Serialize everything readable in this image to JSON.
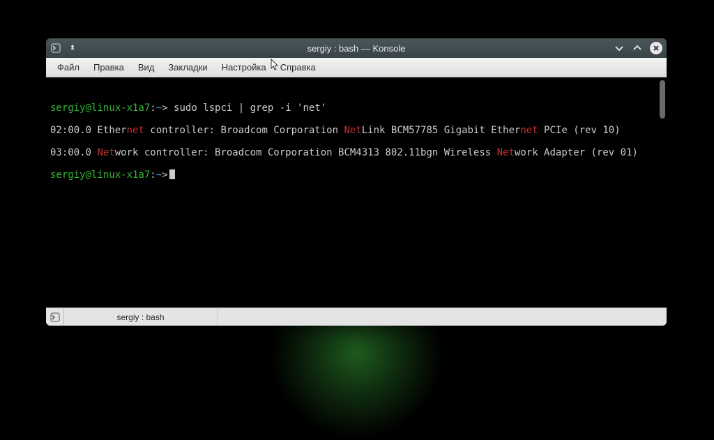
{
  "titlebar": {
    "title": "sergiy : bash — Konsole"
  },
  "menu": {
    "file": "Файл",
    "edit": "Правка",
    "view": "Вид",
    "bookmarks": "Закладки",
    "settings": "Настройка",
    "help": "Справка"
  },
  "terminal": {
    "prompt_user": "sergiy@linux-x1a7",
    "prompt_path": "~",
    "prompt_tail": ">",
    "line1_cmd": " sudo lspci | grep -i 'net'",
    "line2": {
      "a": "02:00.0 Ether",
      "h1": "net",
      "b": " controller: Broadcom Corporation ",
      "h2": "Net",
      "c": "Link BCM57785 Gigabit Ether",
      "h3": "net",
      "d": " PCIe (rev 10)"
    },
    "line3": {
      "a": "03:00.0 ",
      "h1": "Net",
      "b": "work controller: Broadcom Corporation BCM4313 802.11bgn Wireless ",
      "h2": "Net",
      "c": "work Adapter (rev 01)"
    }
  },
  "tab": {
    "label": "sergiy : bash"
  }
}
